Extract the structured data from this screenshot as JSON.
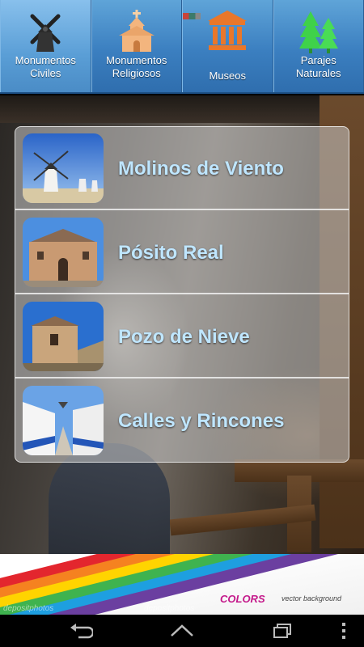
{
  "tabs": [
    {
      "label_line1": "Monumentos",
      "label_line2": "Civiles",
      "icon": "windmill-icon",
      "active": true
    },
    {
      "label_line1": "Monumentos",
      "label_line2": "Religiosos",
      "icon": "chapel-icon",
      "active": false
    },
    {
      "label_line1": "Museos",
      "label_line2": "",
      "icon": "museum-icon",
      "active": false
    },
    {
      "label_line1": "Parajes",
      "label_line2": "Naturales",
      "icon": "trees-icon",
      "active": false
    }
  ],
  "list": {
    "items": [
      {
        "title": "Molinos de Viento",
        "image": "windmills-thumbnail"
      },
      {
        "title": "Pósito Real",
        "image": "posito-real-thumbnail"
      },
      {
        "title": "Pozo de Nieve",
        "image": "pozo-de-nieve-thumbnail"
      },
      {
        "title": "Calles y Rincones",
        "image": "calles-thumbnail"
      }
    ]
  },
  "ad": {
    "brand": "COLORS",
    "subtitle": "vector background",
    "watermark": "depositphotos"
  },
  "colors": {
    "tab_bar": "#3b7fc0",
    "list_title": "#bfe6ff",
    "brand": "#c4188a"
  },
  "navbar": {
    "buttons": [
      "back-icon",
      "home-icon",
      "recents-icon",
      "menu-icon"
    ]
  }
}
